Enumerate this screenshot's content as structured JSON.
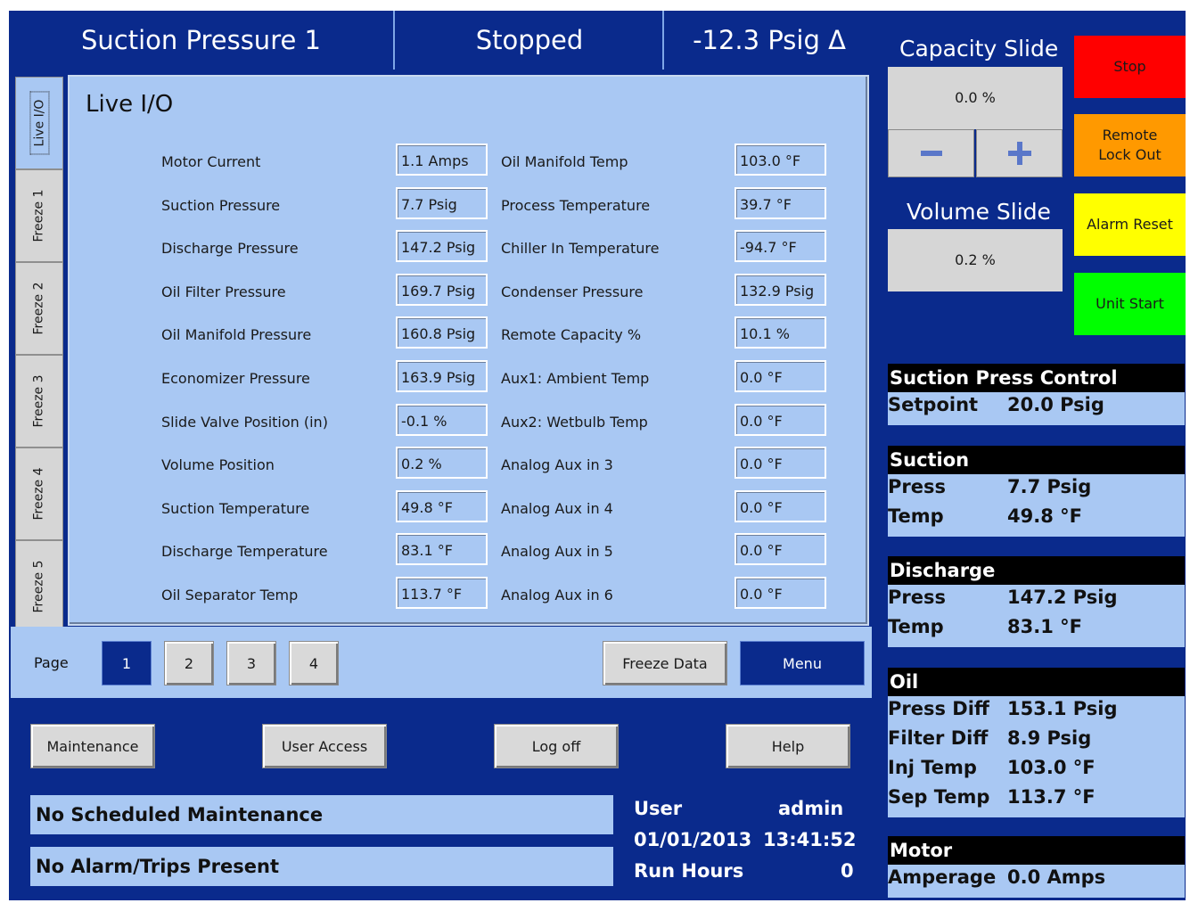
{
  "header": {
    "title": "Suction Pressure 1",
    "status": "Stopped",
    "readout": "-12.3 Psig Δ"
  },
  "tabs": [
    "Live I/O",
    "Freeze 1",
    "Freeze 2",
    "Freeze 3",
    "Freeze 4",
    "Freeze 5"
  ],
  "panel_title": "Live I/O",
  "io_left": [
    {
      "label": "Motor Current",
      "value": "1.1 Amps"
    },
    {
      "label": "Suction Pressure",
      "value": "7.7 Psig"
    },
    {
      "label": "Discharge Pressure",
      "value": "147.2 Psig"
    },
    {
      "label": "Oil Filter Pressure",
      "value": "169.7 Psig"
    },
    {
      "label": "Oil Manifold Pressure",
      "value": "160.8 Psig"
    },
    {
      "label": "Economizer Pressure",
      "value": "163.9 Psig"
    },
    {
      "label": "Slide Valve Position (in)",
      "value": "-0.1 %"
    },
    {
      "label": "Volume Position",
      "value": "0.2 %"
    },
    {
      "label": "Suction Temperature",
      "value": "49.8 °F"
    },
    {
      "label": "Discharge Temperature",
      "value": "83.1 °F"
    },
    {
      "label": "Oil Separator Temp",
      "value": "113.7 °F"
    }
  ],
  "io_right": [
    {
      "label": "Oil Manifold Temp",
      "value": "103.0 °F"
    },
    {
      "label": "Process Temperature",
      "value": "39.7 °F"
    },
    {
      "label": "Chiller In Temperature",
      "value": "-94.7 °F"
    },
    {
      "label": "Condenser Pressure",
      "value": "132.9 Psig"
    },
    {
      "label": "Remote Capacity %",
      "value": "10.1 %"
    },
    {
      "label": "Aux1: Ambient Temp",
      "value": "0.0 °F"
    },
    {
      "label": "Aux2: Wetbulb Temp",
      "value": "0.0 °F"
    },
    {
      "label": "Analog Aux in 3",
      "value": "0.0 °F"
    },
    {
      "label": "Analog Aux in 4",
      "value": "0.0 °F"
    },
    {
      "label": "Analog Aux in 5",
      "value": "0.0 °F"
    },
    {
      "label": "Analog Aux in 6",
      "value": "0.0 °F"
    }
  ],
  "pager": {
    "label": "Page",
    "pages": [
      "1",
      "2",
      "3",
      "4"
    ],
    "current": "1",
    "freeze_label": "Freeze Data",
    "menu_label": "Menu"
  },
  "bottom_buttons": [
    "Maintenance",
    "User Access",
    "Log off",
    "Help"
  ],
  "messages": {
    "maintenance": "No Scheduled Maintenance",
    "alarms": "No Alarm/Trips Present"
  },
  "session": {
    "user_label": "User",
    "user": "admin",
    "date": "01/01/2013",
    "time": "13:41:52",
    "run_hours_label": "Run Hours",
    "run_hours": "0"
  },
  "capacity": {
    "title": "Capacity Slide",
    "value": "0.0 %",
    "minus_icon": "minus-icon",
    "plus_icon": "plus-icon"
  },
  "volume": {
    "title": "Volume Slide",
    "value": "0.2 %"
  },
  "controls": {
    "stop": "Stop",
    "remote_lock_line1": "Remote",
    "remote_lock_line2": "Lock Out",
    "alarm_reset": "Alarm Reset",
    "unit_start": "Unit Start"
  },
  "status_sections": {
    "control": {
      "title": "Suction Press Control",
      "rows": [
        {
          "k": "Setpoint",
          "v": "20.0 Psig"
        }
      ]
    },
    "suction": {
      "title": "Suction",
      "rows": [
        {
          "k": "Press",
          "v": "7.7 Psig"
        },
        {
          "k": "Temp",
          "v": "49.8 °F"
        }
      ]
    },
    "discharge": {
      "title": "Discharge",
      "rows": [
        {
          "k": "Press",
          "v": "147.2 Psig"
        },
        {
          "k": "Temp",
          "v": "83.1 °F"
        }
      ]
    },
    "oil": {
      "title": "Oil",
      "rows": [
        {
          "k": "Press Diff",
          "v": "153.1 Psig"
        },
        {
          "k": "Filter Diff",
          "v": "8.9 Psig"
        },
        {
          "k": "Inj Temp",
          "v": "103.0 °F"
        },
        {
          "k": "Sep Temp",
          "v": "113.7 °F"
        }
      ]
    },
    "motor": {
      "title": "Motor",
      "rows": [
        {
          "k": "Amperage",
          "v": "0.0 Amps"
        }
      ]
    }
  },
  "colors": {
    "frame": "#0a2a8c",
    "panel": "#a9c8f3",
    "stop": "#ff0000",
    "remote_lock": "#ff9900",
    "alarm_reset": "#ffff00",
    "unit_start": "#00ff00"
  }
}
